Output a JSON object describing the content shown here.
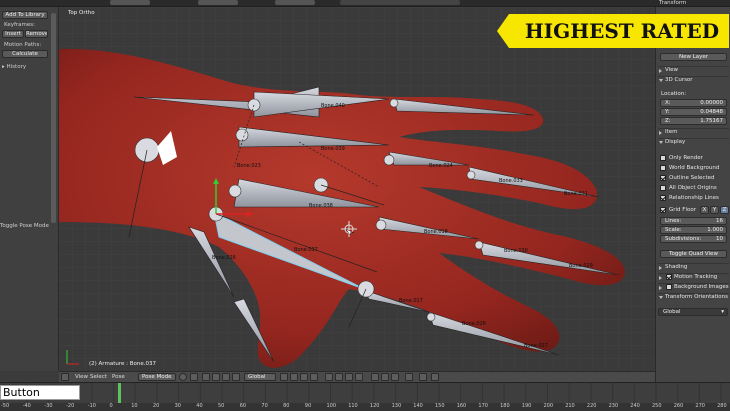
{
  "banner": {
    "text": "HIGHEST RATED"
  },
  "tool_shelf": {
    "add_to_library": "Add To Library",
    "keyframes_label": "Keyframes:",
    "insert": "Insert",
    "remove": "Remove",
    "motion_paths_label": "Motion Paths:",
    "calculate": "Calculate",
    "history": "History",
    "toggle_pose_mode": "Toggle Pose Mode"
  },
  "viewport": {
    "view_name": "Top Ortho",
    "status": "(2) Armature : Bone.037",
    "bone_labels": [
      "Bone.040",
      "Bone.039",
      "Bone.023",
      "Bone.038",
      "Bone.037",
      "Bone.026",
      "Bone.024",
      "Bone.033",
      "Bone.031",
      "Bone.018",
      "Bone.030",
      "Bone.029",
      "Bone.017",
      "Bone.028",
      "Bone.027"
    ]
  },
  "view_toolbar": {
    "view": "View",
    "select": "Select",
    "pose": "Pose",
    "mode": "Pose Mode",
    "orientation": "Global"
  },
  "properties": {
    "top_label": "Transform",
    "new_layer": "New Layer",
    "view": "View",
    "cursor_3d": "3D Cursor",
    "location_label": "Location:",
    "x": {
      "k": "X:",
      "v": "0.00000"
    },
    "y": {
      "k": "Y:",
      "v": "0.04848"
    },
    "z": {
      "k": "Z:",
      "v": "1.75167"
    },
    "item": "Item",
    "display": "Display",
    "only_render": "Only Render",
    "world_background": "World Background",
    "outline_selected": "Outline Selected",
    "all_object_origins": "All Object Origins",
    "relationship_lines": "Relationship Lines",
    "grid_floor": "Grid Floor",
    "axis_x": "X",
    "axis_y": "Y",
    "axis_z": "Z",
    "lines": {
      "k": "Lines:",
      "v": "16"
    },
    "scale": {
      "k": "Scale:",
      "v": "1.000"
    },
    "subdivisions": {
      "k": "Subdivisions:",
      "v": "10"
    },
    "toggle_quad_view": "Toggle Quad View",
    "shading": "Shading",
    "motion_tracking": "Motion Tracking",
    "background_images": "Background Images",
    "transform_orientations": "Transform Orientations",
    "orientation_value": "Global"
  },
  "timeline": {
    "frames": [
      "-50",
      "-40",
      "-30",
      "-20",
      "-10",
      "0",
      "10",
      "20",
      "30",
      "40",
      "50",
      "60",
      "70",
      "80",
      "90",
      "100",
      "110",
      "120",
      "130",
      "140",
      "150",
      "160",
      "170",
      "180",
      "190",
      "200",
      "210",
      "220",
      "230",
      "240",
      "250",
      "260",
      "270",
      "280"
    ]
  },
  "button_widget": {
    "label": "Button"
  },
  "colors": {
    "hand": "#9e2a22",
    "banner": "#f7e600",
    "bone": "#b9bcc4",
    "selected_bone": "#9fd8ee"
  }
}
